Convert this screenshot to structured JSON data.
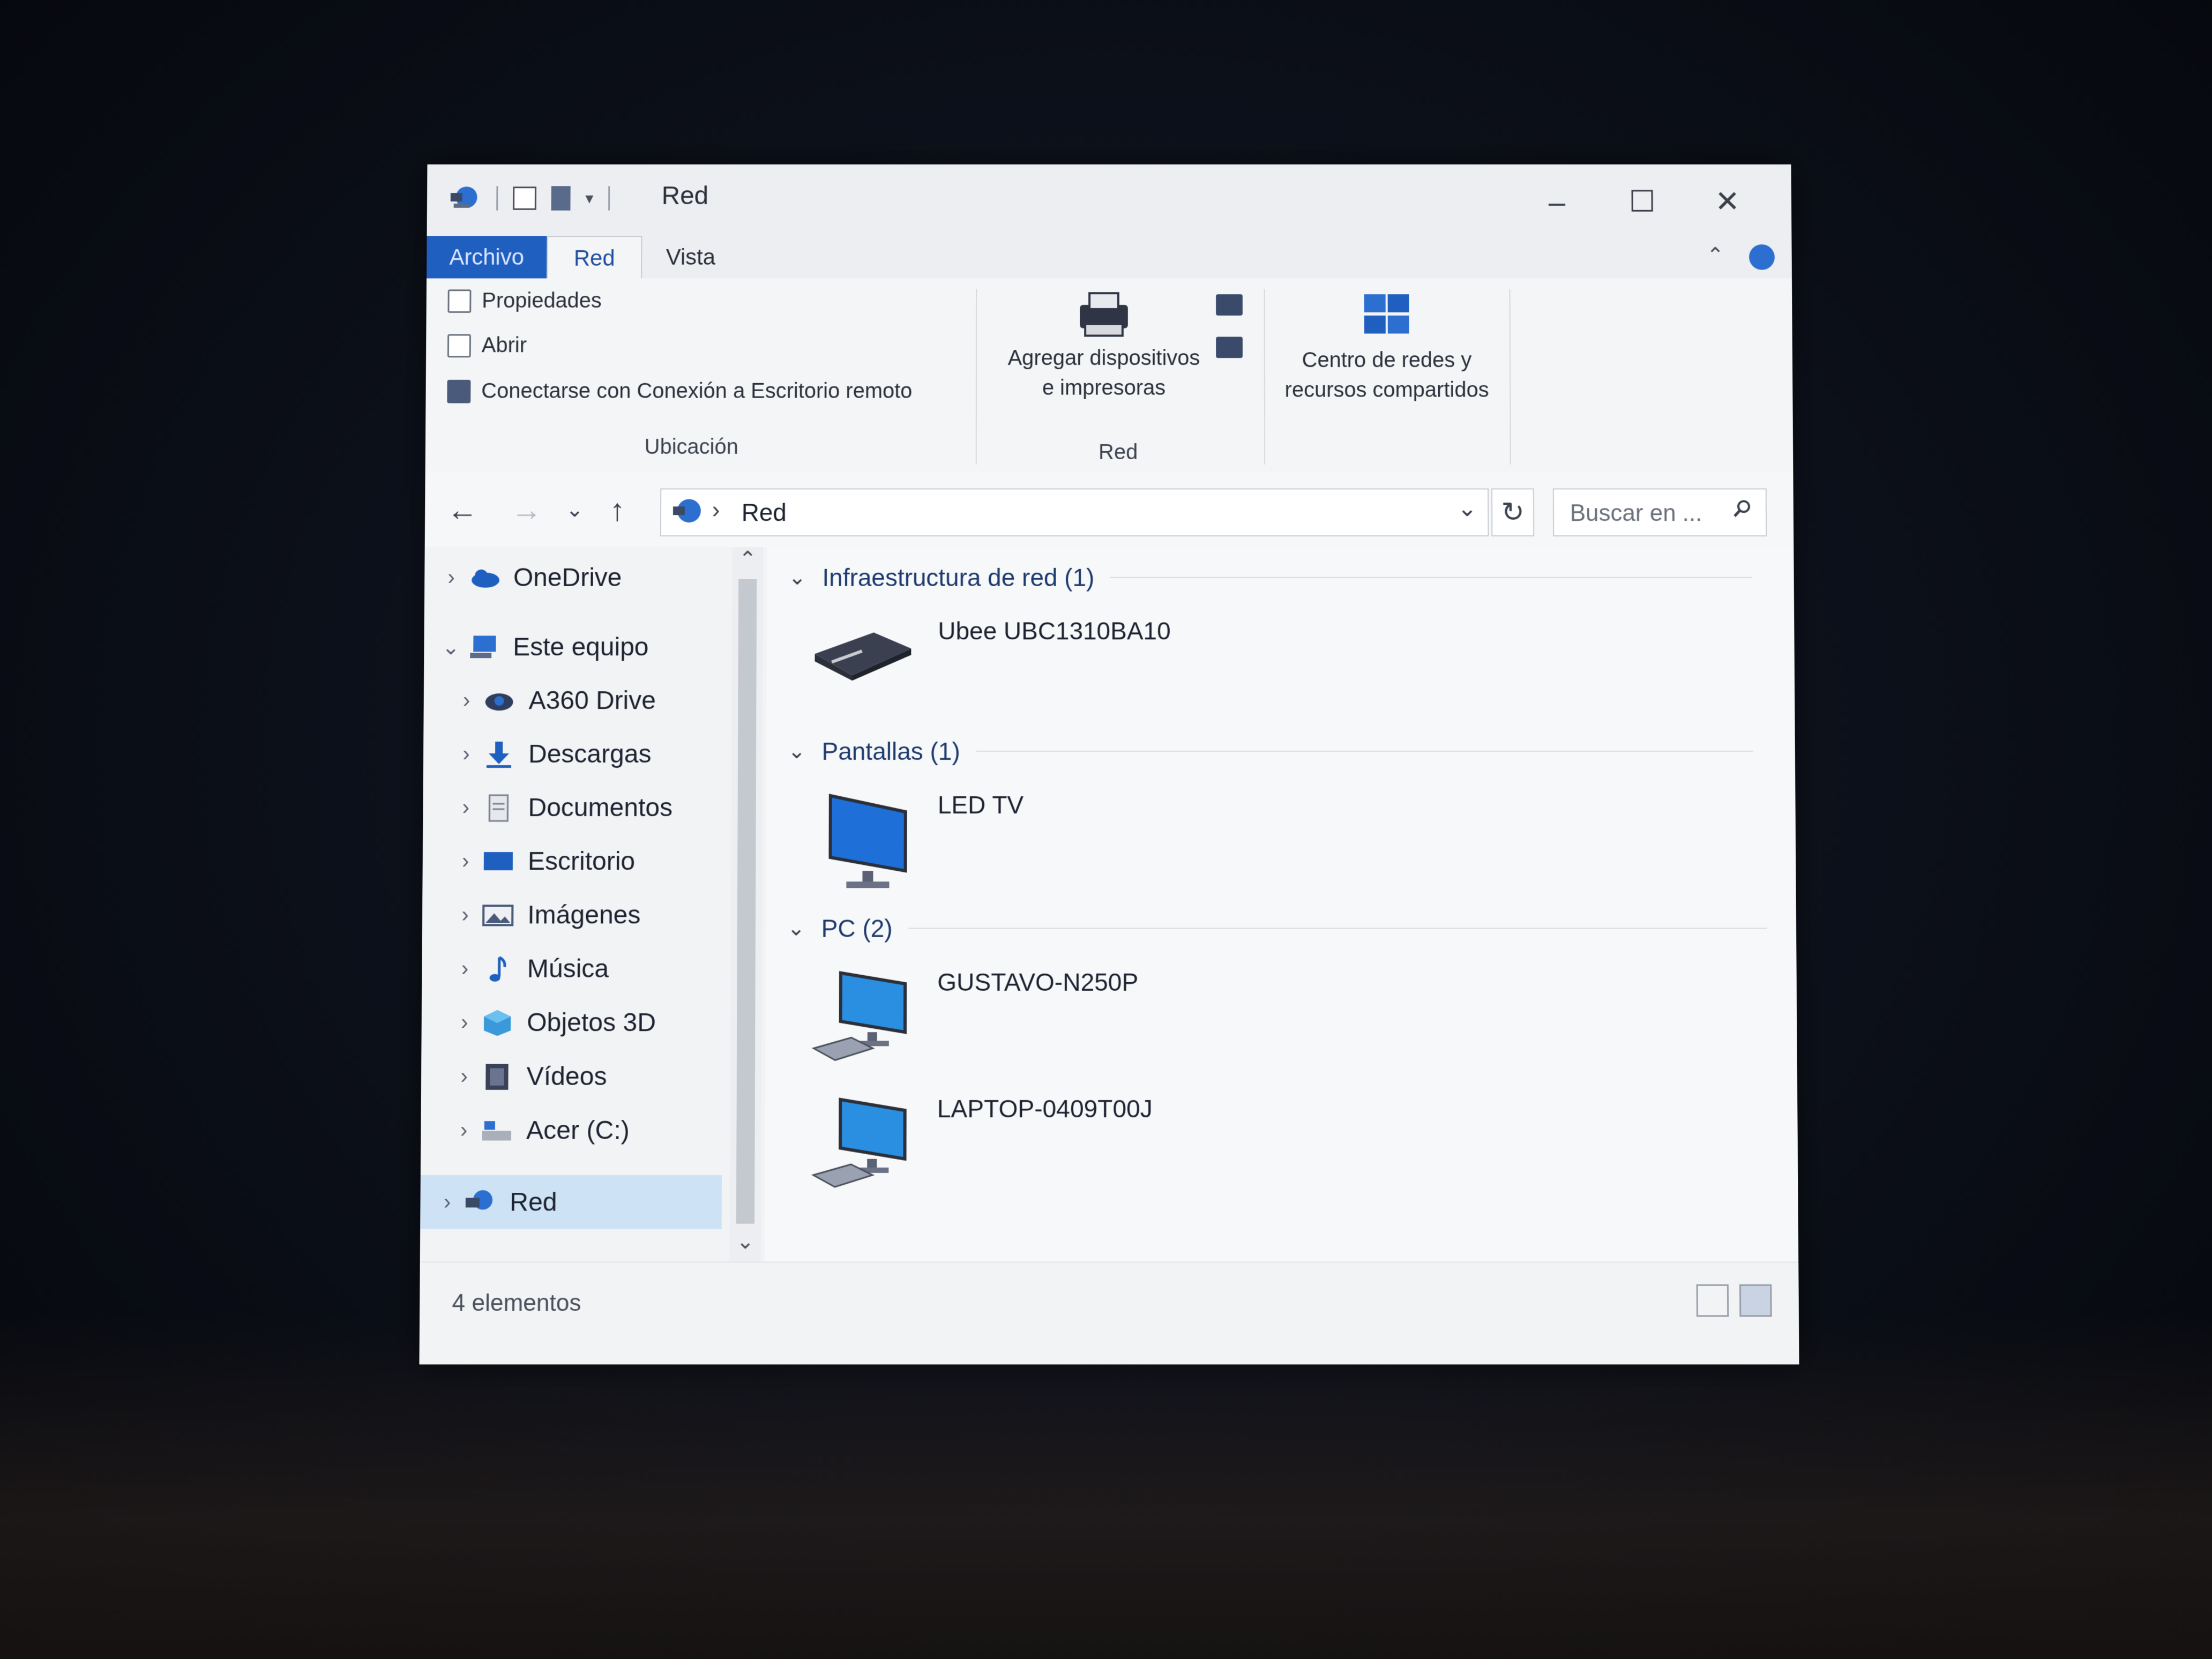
{
  "window": {
    "title": "Red",
    "controls": {
      "minimize": "–",
      "maximize": "☐",
      "close": "✕"
    }
  },
  "ribbon": {
    "tabs": [
      {
        "label": "Archivo"
      },
      {
        "label": "Red"
      },
      {
        "label": "Vista"
      }
    ],
    "location_group": {
      "items": [
        {
          "label": "Propiedades",
          "icon": "properties-icon"
        },
        {
          "label": "Abrir",
          "icon": "open-icon"
        },
        {
          "label": "Conectarse con Conexión a Escritorio remoto",
          "icon": "remote-desktop-icon"
        }
      ],
      "label": "Ubicación"
    },
    "network_group": {
      "add_devices": {
        "line1": "Agregar dispositivos",
        "line2": "e impresoras",
        "icon": "printer-icon"
      },
      "label": "Red"
    },
    "center_group": {
      "line1": "Centro de redes y",
      "line2": "recursos compartidos",
      "icon": "network-center-icon"
    }
  },
  "address": {
    "path": "Red",
    "search_placeholder": "Buscar en ..."
  },
  "nav": {
    "items": [
      {
        "label": "OneDrive",
        "icon": "onedrive-icon"
      },
      {
        "label": "Este equipo",
        "icon": "this-pc-icon"
      },
      {
        "label": "A360 Drive",
        "icon": "a360-drive-icon"
      },
      {
        "label": "Descargas",
        "icon": "downloads-icon"
      },
      {
        "label": "Documentos",
        "icon": "documents-icon"
      },
      {
        "label": "Escritorio",
        "icon": "desktop-icon"
      },
      {
        "label": "Imágenes",
        "icon": "pictures-icon"
      },
      {
        "label": "Música",
        "icon": "music-icon"
      },
      {
        "label": "Objetos 3D",
        "icon": "3d-objects-icon"
      },
      {
        "label": "Vídeos",
        "icon": "videos-icon"
      },
      {
        "label": "Acer (C:)",
        "icon": "drive-icon"
      },
      {
        "label": "Red",
        "icon": "network-icon"
      }
    ]
  },
  "content": {
    "groups": [
      {
        "header": "Infraestructura de red (1)",
        "devices": [
          {
            "name": "Ubee UBC1310BA10",
            "icon": "router-icon"
          }
        ]
      },
      {
        "header": "Pantallas (1)",
        "devices": [
          {
            "name": "LED TV",
            "icon": "monitor-icon"
          }
        ]
      },
      {
        "header": "PC (2)",
        "devices": [
          {
            "name": "GUSTAVO-N250P",
            "icon": "computer-icon"
          },
          {
            "name": "LAPTOP-0409T00J",
            "icon": "computer-icon"
          }
        ]
      }
    ]
  },
  "status": {
    "count": "4 elementos"
  },
  "colors": {
    "accent": "#1f5fbf",
    "selection": "#cde3f5"
  }
}
